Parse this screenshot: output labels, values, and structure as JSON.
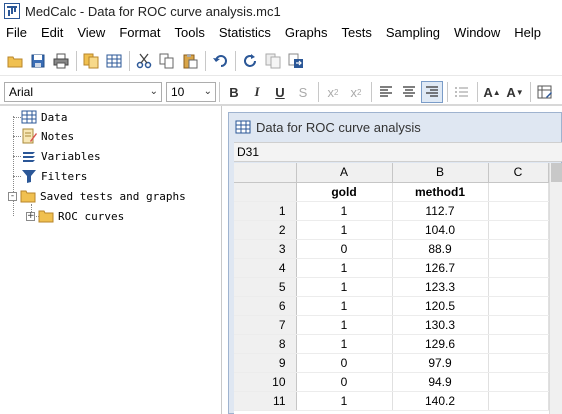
{
  "window": {
    "title": "MedCalc - Data for ROC curve analysis.mc1"
  },
  "menu": [
    "File",
    "Edit",
    "View",
    "Format",
    "Tools",
    "Statistics",
    "Graphs",
    "Tests",
    "Sampling",
    "Window",
    "Help"
  ],
  "toolbar": {
    "icons": [
      "open-folder-icon",
      "save-icon",
      "print-icon",
      "copy-sheet-icon",
      "spreadsheet-icon",
      "cut-icon",
      "copy-icon",
      "paste-icon",
      "undo-icon",
      "refresh-icon",
      "duplicate-icon",
      "export-icon"
    ]
  },
  "format_bar": {
    "font": "Arial",
    "size": "10",
    "bold": "B",
    "italic": "I",
    "underline": "U",
    "strike": "S",
    "subscript": "x",
    "subscript_mark": "2",
    "superscript": "x",
    "superscript_mark": "2",
    "grow": "A",
    "shrink": "A"
  },
  "tree": {
    "items": [
      {
        "label": "Data",
        "icon": "data-grid-icon"
      },
      {
        "label": "Notes",
        "icon": "notes-icon"
      },
      {
        "label": "Variables",
        "icon": "variables-icon"
      },
      {
        "label": "Filters",
        "icon": "filter-icon"
      },
      {
        "label": "Saved tests and graphs",
        "icon": "folder-icon"
      },
      {
        "label": "ROC curves",
        "icon": "folder-icon"
      }
    ],
    "expander_collapsed": "+",
    "expander_expanded": "-"
  },
  "spreadsheet": {
    "title": "Data for ROC curve analysis",
    "cell_ref": "D31",
    "columns": [
      "A",
      "B",
      "C"
    ],
    "names": [
      "gold",
      "method1",
      ""
    ],
    "rows": [
      {
        "n": "1",
        "a": "1",
        "b": "112.7"
      },
      {
        "n": "2",
        "a": "1",
        "b": "104.0"
      },
      {
        "n": "3",
        "a": "0",
        "b": "88.9"
      },
      {
        "n": "4",
        "a": "1",
        "b": "126.7"
      },
      {
        "n": "5",
        "a": "1",
        "b": "123.3"
      },
      {
        "n": "6",
        "a": "1",
        "b": "120.5"
      },
      {
        "n": "7",
        "a": "1",
        "b": "130.3"
      },
      {
        "n": "8",
        "a": "1",
        "b": "129.6"
      },
      {
        "n": "9",
        "a": "0",
        "b": "97.9"
      },
      {
        "n": "10",
        "a": "0",
        "b": "94.9"
      },
      {
        "n": "11",
        "a": "1",
        "b": "140.2"
      }
    ]
  },
  "colors": {
    "accent": "#2b5797",
    "child_frame": "#dfe7f2",
    "header_gray": "#f0f0f0"
  }
}
